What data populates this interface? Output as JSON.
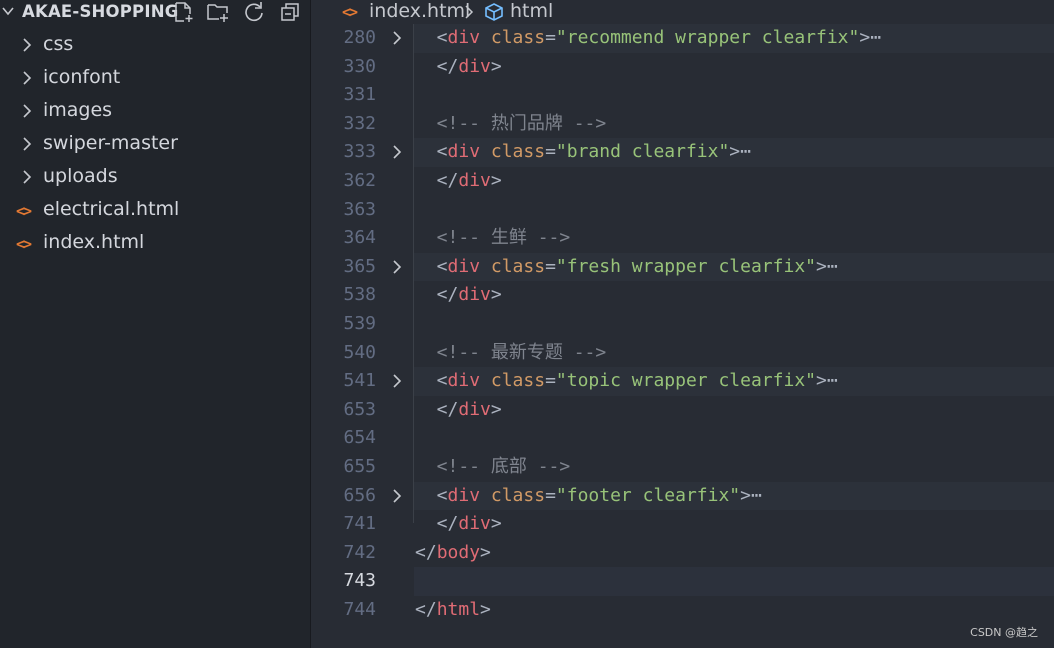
{
  "explorer": {
    "title": "AKAE-SHOPPING",
    "actions": [
      "new-file-icon",
      "new-folder-icon",
      "refresh-icon",
      "collapse-all-icon"
    ],
    "items": [
      {
        "label": "css",
        "type": "folder"
      },
      {
        "label": "iconfont",
        "type": "folder"
      },
      {
        "label": "images",
        "type": "folder"
      },
      {
        "label": "swiper-master",
        "type": "folder"
      },
      {
        "label": "uploads",
        "type": "folder"
      },
      {
        "label": "electrical.html",
        "type": "html-file",
        "icon": "<>"
      },
      {
        "label": "index.html",
        "type": "html-file",
        "icon": "<>"
      }
    ]
  },
  "breadcrumb": {
    "file_icon": "<>",
    "file": "index.html",
    "node": "html"
  },
  "editor": {
    "lines": [
      {
        "num": "280",
        "folded": true,
        "highlight": true,
        "parts": [
          {
            "t": "  <",
            "c": "p"
          },
          {
            "t": "div",
            "c": "tag"
          },
          {
            "t": " ",
            "c": "p"
          },
          {
            "t": "class",
            "c": "attr"
          },
          {
            "t": "=",
            "c": "p"
          },
          {
            "t": "\"recommend wrapper clearfix\"",
            "c": "str"
          },
          {
            "t": ">",
            "c": "p"
          },
          {
            "t": "⋯",
            "c": "ell"
          }
        ]
      },
      {
        "num": "330",
        "parts": [
          {
            "t": "  </",
            "c": "p"
          },
          {
            "t": "div",
            "c": "tag"
          },
          {
            "t": ">",
            "c": "p"
          }
        ]
      },
      {
        "num": "331",
        "parts": []
      },
      {
        "num": "332",
        "parts": [
          {
            "t": "  <!-- 热门品牌 -->",
            "c": "com"
          }
        ]
      },
      {
        "num": "333",
        "folded": true,
        "highlight": true,
        "parts": [
          {
            "t": "  <",
            "c": "p"
          },
          {
            "t": "div",
            "c": "tag"
          },
          {
            "t": " ",
            "c": "p"
          },
          {
            "t": "class",
            "c": "attr"
          },
          {
            "t": "=",
            "c": "p"
          },
          {
            "t": "\"brand clearfix\"",
            "c": "str"
          },
          {
            "t": ">",
            "c": "p"
          },
          {
            "t": "⋯",
            "c": "ell"
          }
        ]
      },
      {
        "num": "362",
        "parts": [
          {
            "t": "  </",
            "c": "p"
          },
          {
            "t": "div",
            "c": "tag"
          },
          {
            "t": ">",
            "c": "p"
          }
        ]
      },
      {
        "num": "363",
        "parts": []
      },
      {
        "num": "364",
        "parts": [
          {
            "t": "  <!-- 生鲜 -->",
            "c": "com"
          }
        ]
      },
      {
        "num": "365",
        "folded": true,
        "highlight": true,
        "parts": [
          {
            "t": "  <",
            "c": "p"
          },
          {
            "t": "div",
            "c": "tag"
          },
          {
            "t": " ",
            "c": "p"
          },
          {
            "t": "class",
            "c": "attr"
          },
          {
            "t": "=",
            "c": "p"
          },
          {
            "t": "\"fresh wrapper clearfix\"",
            "c": "str"
          },
          {
            "t": ">",
            "c": "p"
          },
          {
            "t": "⋯",
            "c": "ell"
          }
        ]
      },
      {
        "num": "538",
        "parts": [
          {
            "t": "  </",
            "c": "p"
          },
          {
            "t": "div",
            "c": "tag"
          },
          {
            "t": ">",
            "c": "p"
          }
        ]
      },
      {
        "num": "539",
        "parts": []
      },
      {
        "num": "540",
        "parts": [
          {
            "t": "  <!-- 最新专题 -->",
            "c": "com"
          }
        ]
      },
      {
        "num": "541",
        "folded": true,
        "highlight": true,
        "parts": [
          {
            "t": "  <",
            "c": "p"
          },
          {
            "t": "div",
            "c": "tag"
          },
          {
            "t": " ",
            "c": "p"
          },
          {
            "t": "class",
            "c": "attr"
          },
          {
            "t": "=",
            "c": "p"
          },
          {
            "t": "\"topic wrapper clearfix\"",
            "c": "str"
          },
          {
            "t": ">",
            "c": "p"
          },
          {
            "t": "⋯",
            "c": "ell"
          }
        ]
      },
      {
        "num": "653",
        "parts": [
          {
            "t": "  </",
            "c": "p"
          },
          {
            "t": "div",
            "c": "tag"
          },
          {
            "t": ">",
            "c": "p"
          }
        ]
      },
      {
        "num": "654",
        "parts": []
      },
      {
        "num": "655",
        "parts": [
          {
            "t": "  <!-- 底部 -->",
            "c": "com"
          }
        ]
      },
      {
        "num": "656",
        "folded": true,
        "highlight": true,
        "parts": [
          {
            "t": "  <",
            "c": "p"
          },
          {
            "t": "div",
            "c": "tag"
          },
          {
            "t": " ",
            "c": "p"
          },
          {
            "t": "class",
            "c": "attr"
          },
          {
            "t": "=",
            "c": "p"
          },
          {
            "t": "\"footer clearfix\"",
            "c": "str"
          },
          {
            "t": ">",
            "c": "p"
          },
          {
            "t": "⋯",
            "c": "ell"
          }
        ]
      },
      {
        "num": "741",
        "parts": [
          {
            "t": "  </",
            "c": "p"
          },
          {
            "t": "div",
            "c": "tag"
          },
          {
            "t": ">",
            "c": "p"
          }
        ]
      },
      {
        "num": "742",
        "parts": [
          {
            "t": "</",
            "c": "p"
          },
          {
            "t": "body",
            "c": "tag"
          },
          {
            "t": ">",
            "c": "p"
          }
        ]
      },
      {
        "num": "743",
        "current": true,
        "parts": []
      },
      {
        "num": "744",
        "parts": [
          {
            "t": "</",
            "c": "p"
          },
          {
            "t": "html",
            "c": "tag"
          },
          {
            "t": ">",
            "c": "p"
          }
        ]
      }
    ]
  },
  "watermark": "CSDN @趋之",
  "colors": {
    "tag": "#e06c75",
    "attr": "#d19a66",
    "string": "#98c379",
    "comment": "#7f848e",
    "punct": "#abb2bf",
    "html_icon": "#e37933"
  }
}
